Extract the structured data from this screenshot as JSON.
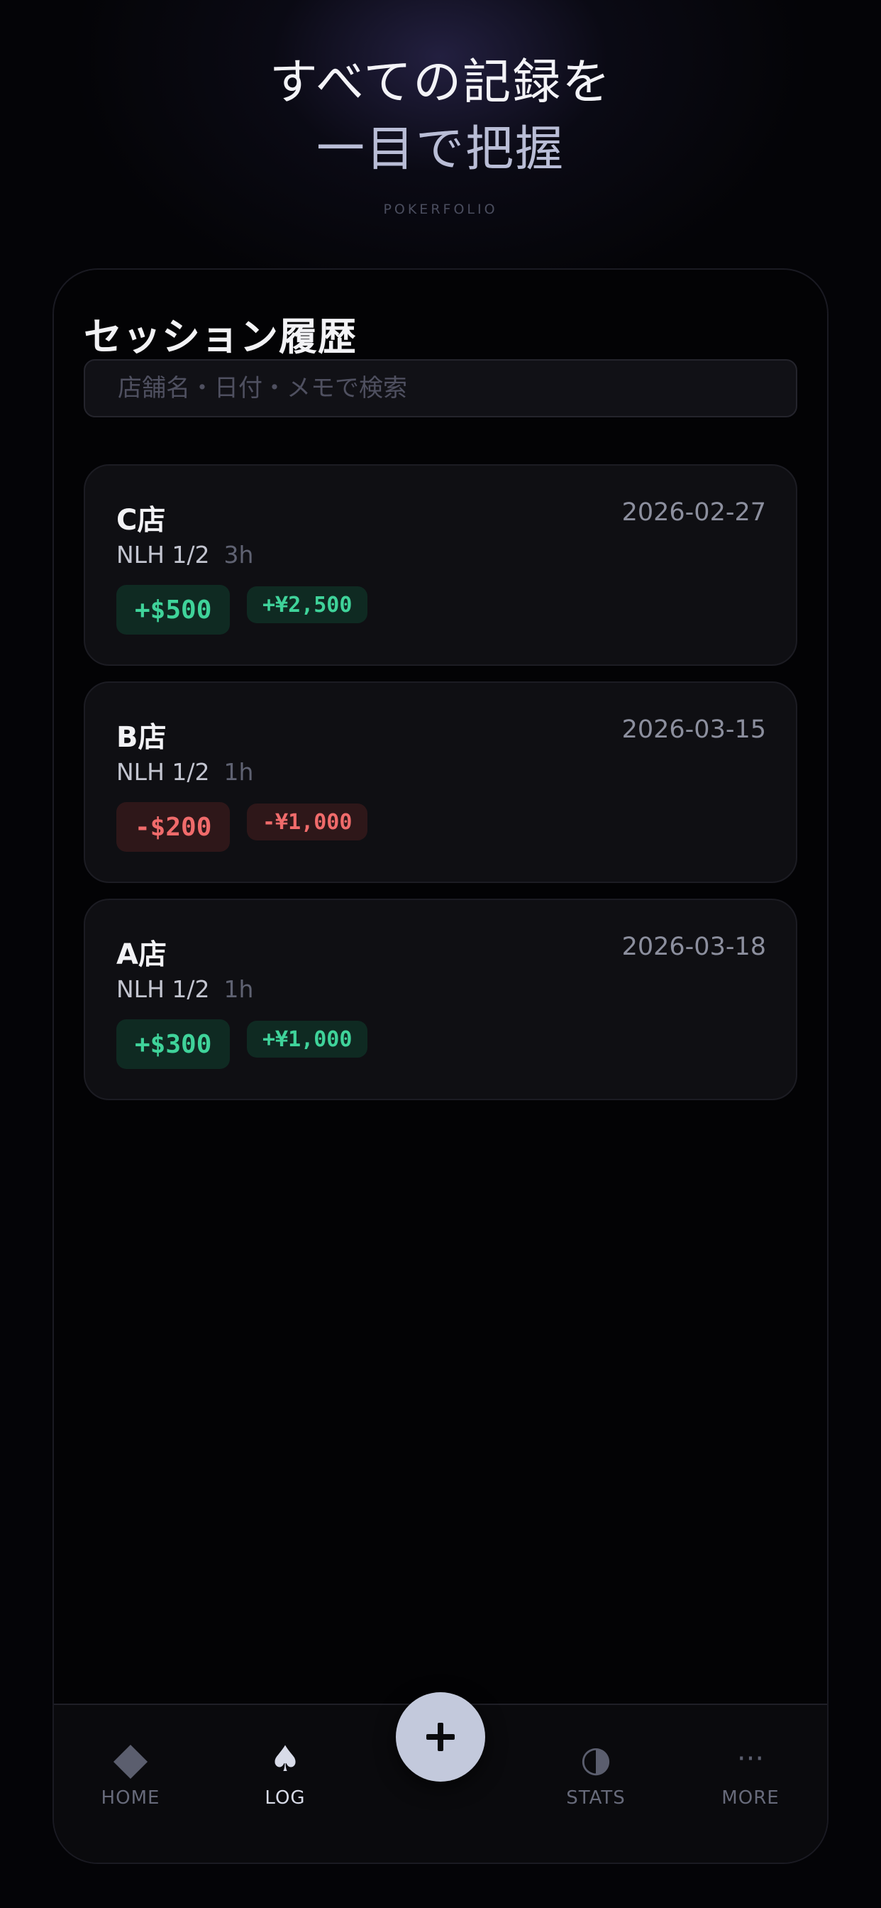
{
  "hero": {
    "line1": "すべての記録を",
    "line2": "一目で把握",
    "brand": "POKERFOLIO"
  },
  "screen": {
    "title": "セッション履歴",
    "search_placeholder": "店舗名・日付・メモで検索"
  },
  "sessions": [
    {
      "venue": "C店",
      "date": "2026-02-27",
      "game": "NLH 1/2",
      "duration": "3h",
      "result": "+$500",
      "result_sub": "+¥2,500",
      "status": "positive"
    },
    {
      "venue": "B店",
      "date": "2026-03-15",
      "game": "NLH 1/2",
      "duration": "1h",
      "result": "-$200",
      "result_sub": "-¥1,000",
      "status": "negative"
    },
    {
      "venue": "A店",
      "date": "2026-03-18",
      "game": "NLH 1/2",
      "duration": "1h",
      "result": "+$300",
      "result_sub": "+¥1,000",
      "status": "positive"
    }
  ],
  "tabbar": {
    "home": {
      "label": "HOME",
      "icon": "diamond-icon"
    },
    "log": {
      "label": "LOG",
      "icon": "spade-icon",
      "active": true
    },
    "add": {
      "icon": "plus-icon"
    },
    "stats": {
      "label": "STATS",
      "icon": "half-circle-icon"
    },
    "more": {
      "label": "MORE",
      "icon": "ellipsis-icon"
    }
  },
  "colors": {
    "positive": "#3fd39a",
    "negative": "#f06b6b",
    "fab": "#c3c9dc"
  }
}
